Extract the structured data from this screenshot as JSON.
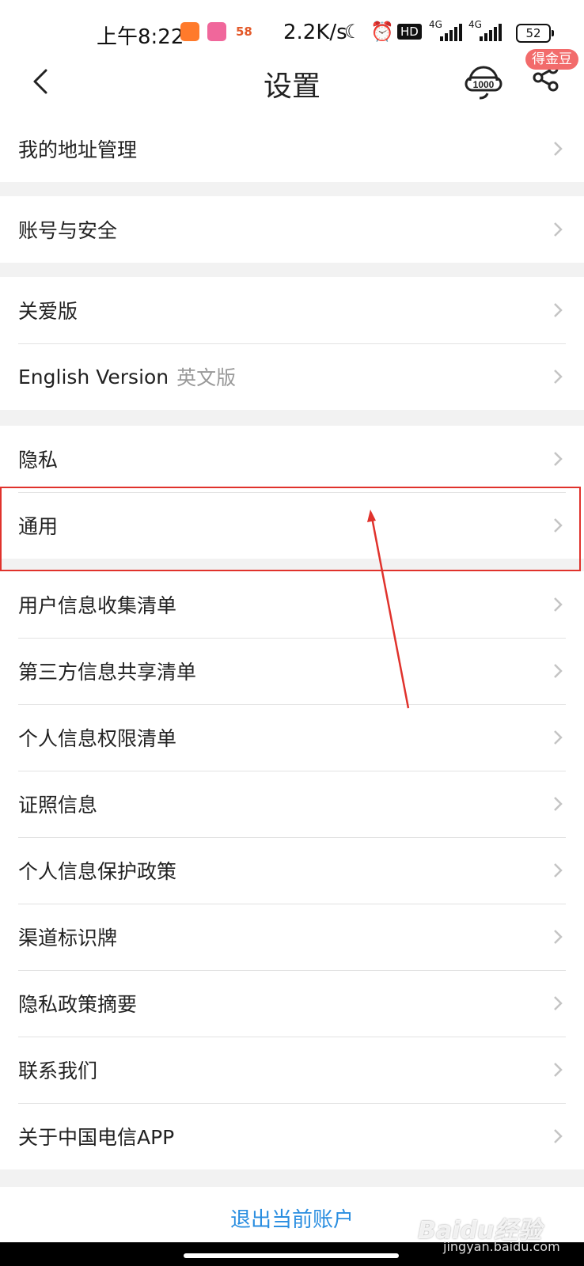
{
  "status_bar": {
    "time": "上午8:22",
    "app_icons": [
      "taobao-icon",
      "bilibili-icon",
      "58-icon"
    ],
    "app_58_label": "58",
    "net_speed": "2.2K/s",
    "hd_label": "HD",
    "network_1": "4G",
    "network_2": "4G",
    "battery": "52"
  },
  "nav": {
    "title": "设置",
    "badge": "得金豆"
  },
  "sections": [
    {
      "rows": [
        {
          "label": "我的地址管理"
        }
      ]
    },
    {
      "rows": [
        {
          "label": "账号与安全"
        }
      ]
    },
    {
      "rows": [
        {
          "label": "关爱版"
        },
        {
          "label": "English Version",
          "sub": "英文版"
        }
      ]
    },
    {
      "rows": [
        {
          "label": "隐私"
        },
        {
          "label": "通用"
        }
      ]
    },
    {
      "rows": [
        {
          "label": "用户信息收集清单"
        },
        {
          "label": "第三方信息共享清单"
        },
        {
          "label": "个人信息权限清单"
        },
        {
          "label": "证照信息"
        },
        {
          "label": "个人信息保护政策"
        },
        {
          "label": "渠道标识牌"
        },
        {
          "label": "隐私政策摘要"
        },
        {
          "label": "联系我们"
        },
        {
          "label": "关于中国电信APP"
        }
      ]
    }
  ],
  "logout": "退出当前账户",
  "watermark": {
    "brand": "Baidu经验",
    "url": "jingyan.baidu.com"
  },
  "colors": {
    "accent_blue": "#2a8ee0",
    "highlight_red": "#e0322c",
    "badge_red": "#f26b6b"
  }
}
